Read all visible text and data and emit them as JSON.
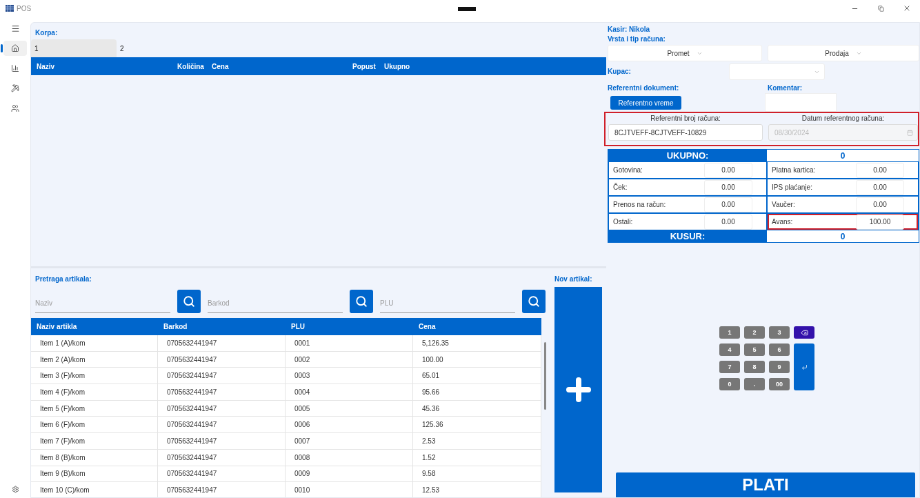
{
  "window": {
    "title": "POS"
  },
  "nav": [
    {
      "kind": "home",
      "selected": true
    },
    {
      "kind": "chart",
      "selected": false
    },
    {
      "kind": "tool",
      "selected": false
    },
    {
      "kind": "people",
      "selected": false
    }
  ],
  "cart": {
    "label": "Korpa:",
    "tabs": [
      {
        "label": "1",
        "selected": true
      },
      {
        "label": "2",
        "selected": false
      }
    ],
    "columns": [
      "Naziv",
      "Količina",
      "Cena",
      "Popust",
      "Ukupno"
    ]
  },
  "search": {
    "label": "Pretraga artikala:",
    "fields": [
      {
        "placeholder": "Naziv"
      },
      {
        "placeholder": "Barkod"
      },
      {
        "placeholder": "PLU"
      }
    ]
  },
  "new_item": {
    "label": "Nov artikal:"
  },
  "items": {
    "columns": [
      "Naziv artikla",
      "Barkod",
      "PLU",
      "Cena"
    ],
    "rows": [
      [
        "Item 1 (A)/kom",
        "0705632441947",
        "0001",
        "5,126.35"
      ],
      [
        "Item 2 (A)/kom",
        "0705632441947",
        "0002",
        "100.00"
      ],
      [
        "Item 3 (F)/kom",
        "0705632441947",
        "0003",
        "65.01"
      ],
      [
        "Item 4 (F)/kom",
        "0705632441947",
        "0004",
        "95.66"
      ],
      [
        "Item 5 (F)/kom",
        "0705632441947",
        "0005",
        "45.36"
      ],
      [
        "Item 6 (F)/kom",
        "0705632441947",
        "0006",
        "125.36"
      ],
      [
        "Item 7 (F)/kom",
        "0705632441947",
        "0007",
        "2.53"
      ],
      [
        "Item 8 (B)/kom",
        "0705632441947",
        "0008",
        "1.52"
      ],
      [
        "Item 9 (B)/kom",
        "0705632441947",
        "0009",
        "9.58"
      ],
      [
        "Item 10 (C)/kom",
        "0705632441947",
        "0010",
        "12.53"
      ]
    ]
  },
  "receipt": {
    "cashier": "Kasir: Nikola",
    "type_label": "Vrsta i tip računa:",
    "type": "Promet",
    "subtype": "Prodaja",
    "customer_label": "Kupac:",
    "ref_doc_label": "Referentni dokument:",
    "comment_label": "Komentar:",
    "ref_time_button": "Referentno vreme",
    "reference": {
      "highlighted": true,
      "number_label": "Referentni broj računa:",
      "number": "8CJTVEFF-8CJTVEFF-10829",
      "date_label": "Datum referentnog računa:",
      "date": "08/30/2024",
      "date_disabled": true
    }
  },
  "totals": {
    "total_label": "UKUPNO:",
    "total": "0",
    "payments": [
      {
        "label": "Gotovina:",
        "value": "0.00",
        "highlighted": false
      },
      {
        "label": "Platna kartica:",
        "value": "0.00",
        "highlighted": false
      },
      {
        "label": "Ček:",
        "value": "0.00",
        "highlighted": false
      },
      {
        "label": "IPS plaćanje:",
        "value": "0.00",
        "highlighted": false
      },
      {
        "label": "Prenos na račun:",
        "value": "0.00",
        "highlighted": false
      },
      {
        "label": "Vaučer:",
        "value": "0.00",
        "highlighted": false
      },
      {
        "label": "Ostali:",
        "value": "0.00",
        "highlighted": false
      },
      {
        "label": "Avans:",
        "value": "100.00",
        "highlighted": true
      }
    ],
    "change_label": "KUSUR:",
    "change": "0"
  },
  "keypad": [
    {
      "kind": "digit",
      "label": "1"
    },
    {
      "kind": "digit",
      "label": "2"
    },
    {
      "kind": "digit",
      "label": "3"
    },
    {
      "kind": "backspace"
    },
    {
      "kind": "digit",
      "label": "4"
    },
    {
      "kind": "digit",
      "label": "5"
    },
    {
      "kind": "digit",
      "label": "6"
    },
    {
      "kind": "enter"
    },
    {
      "kind": "digit",
      "label": "7"
    },
    {
      "kind": "digit",
      "label": "8"
    },
    {
      "kind": "digit",
      "label": "9"
    },
    {
      "kind": "digit",
      "label": "0"
    },
    {
      "kind": "digit",
      "label": "."
    },
    {
      "kind": "digit",
      "label": "00"
    }
  ],
  "pay_button": "PLATI"
}
